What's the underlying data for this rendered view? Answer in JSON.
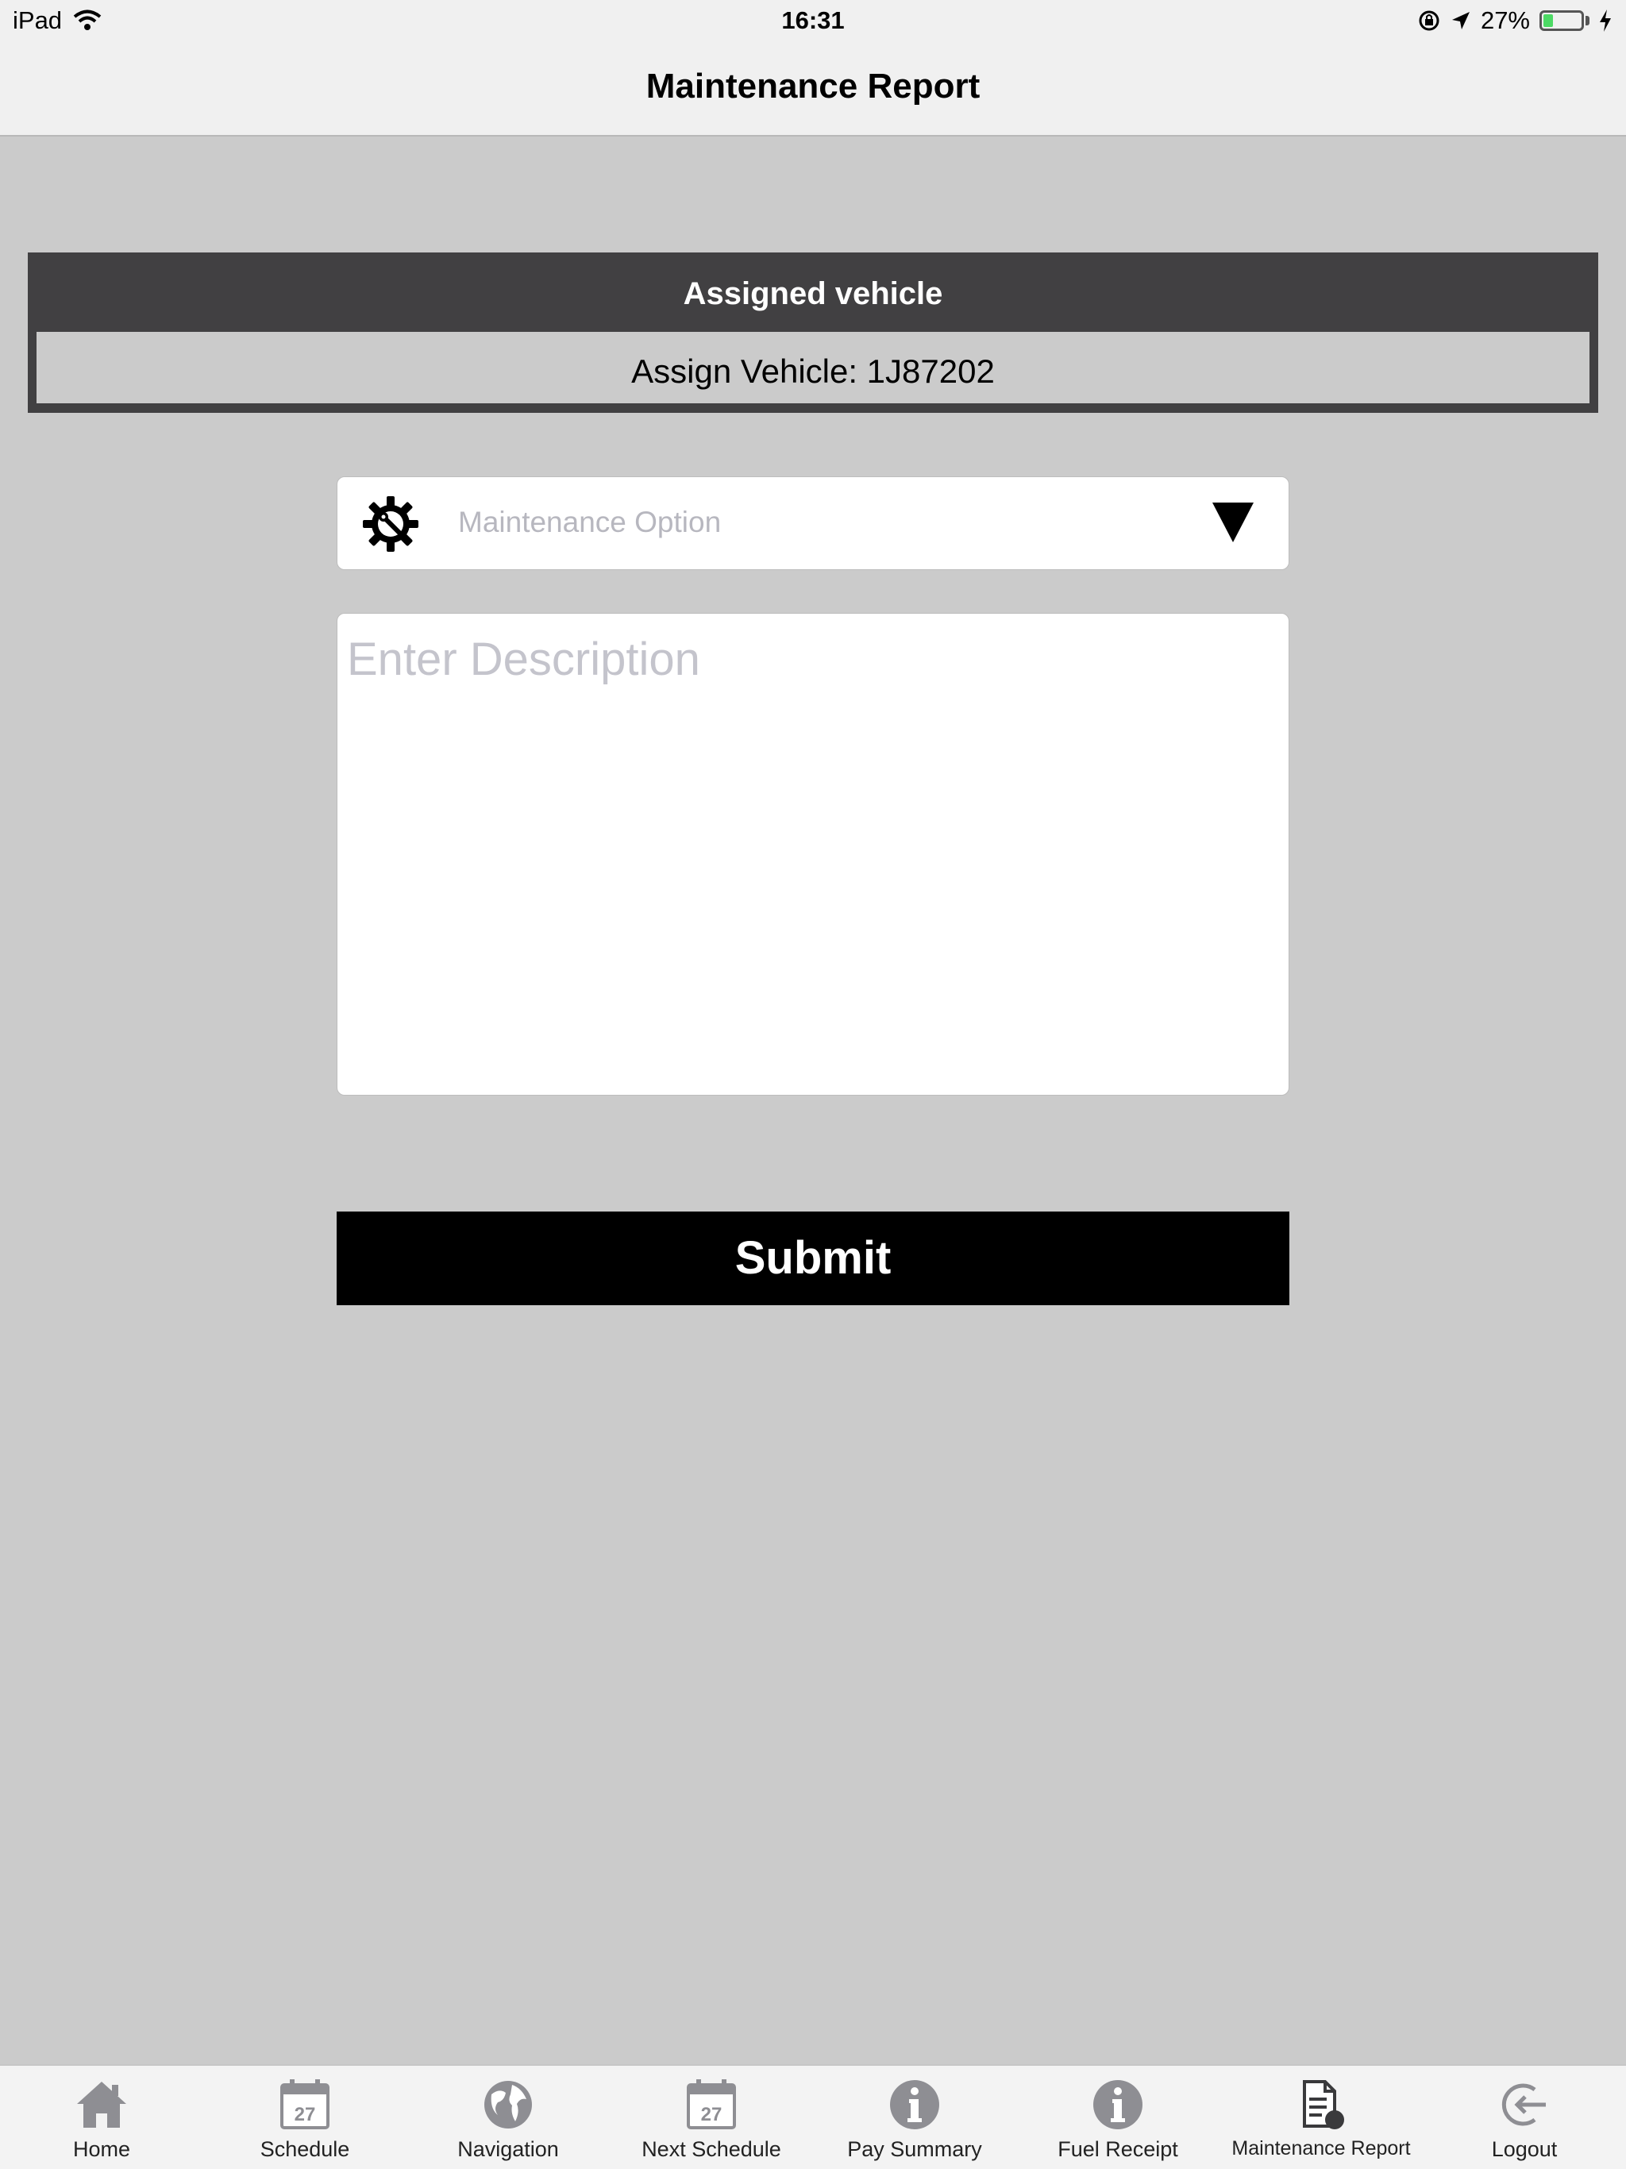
{
  "status_bar": {
    "device": "iPad",
    "time": "16:31",
    "battery_percent": "27%",
    "battery_level": 0.27,
    "icons": [
      "wifi-icon",
      "rotation-lock-icon",
      "location-icon",
      "battery-icon",
      "charging-icon"
    ]
  },
  "nav": {
    "title": "Maintenance Report"
  },
  "vehicle": {
    "header": "Assigned vehicle",
    "value": "Assign Vehicle: 1J87202"
  },
  "form": {
    "option_placeholder": "Maintenance Option",
    "description_placeholder": "Enter Description",
    "submit_label": "Submit"
  },
  "tabs": [
    {
      "label": "Home",
      "icon": "home-icon"
    },
    {
      "label": "Schedule",
      "icon": "calendar-icon",
      "icon_text": "27"
    },
    {
      "label": "Navigation",
      "icon": "globe-icon"
    },
    {
      "label": "Next Schedule",
      "icon": "calendar-icon",
      "icon_text": "27"
    },
    {
      "label": "Pay Summary",
      "icon": "info-icon"
    },
    {
      "label": "Fuel Receipt",
      "icon": "info-icon"
    },
    {
      "label": "Maintenance Report",
      "icon": "report-icon"
    },
    {
      "label": "Logout",
      "icon": "logout-icon"
    }
  ],
  "colors": {
    "background": "#cbcbcb",
    "header_dark": "#414042",
    "button": "#000000",
    "tab_icon": "#8e8e93",
    "battery": "#4cd964"
  }
}
